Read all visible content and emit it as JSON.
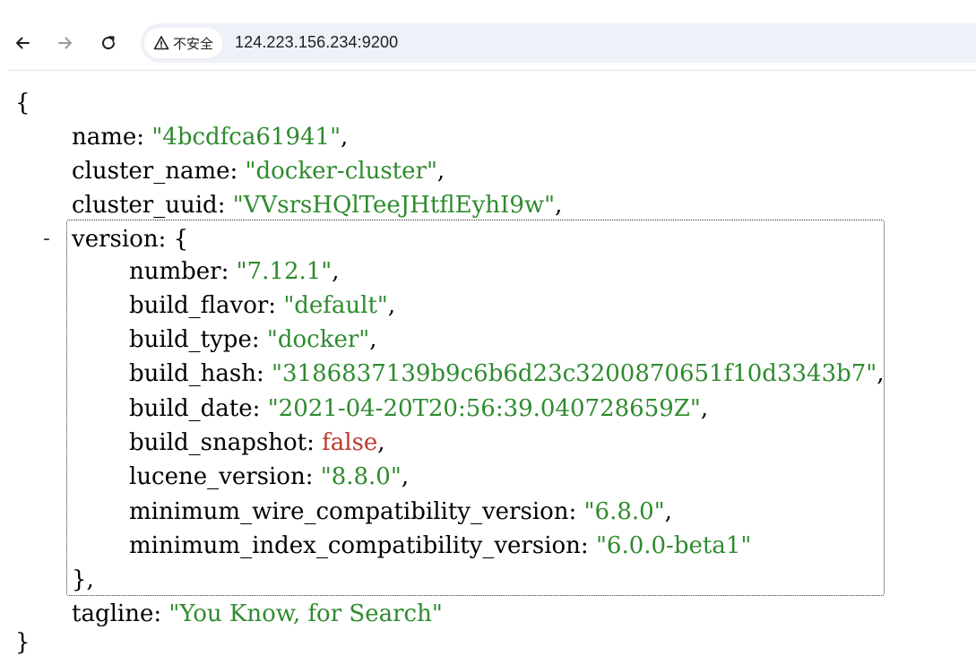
{
  "browser": {
    "security_label": "不安全",
    "url": "124.223.156.234:9200",
    "icons": {
      "back": "arrow-left-icon",
      "forward": "arrow-right-icon",
      "reload": "reload-icon",
      "warning": "warning-triangle-icon"
    }
  },
  "json": {
    "open_brace": "{",
    "close_brace": "}",
    "collapse_symbol": "-",
    "name": {
      "key": "name",
      "value": "\"4bcdfca61941\""
    },
    "cluster_name": {
      "key": "cluster_name",
      "value": "\"docker-cluster\""
    },
    "cluster_uuid": {
      "key": "cluster_uuid",
      "value": "\"VVsrsHQlTeeJHtflEyhI9w\""
    },
    "version": {
      "key": "version",
      "open": "{",
      "close": "},",
      "number": {
        "key": "number",
        "value": "\"7.12.1\""
      },
      "build_flavor": {
        "key": "build_flavor",
        "value": "\"default\""
      },
      "build_type": {
        "key": "build_type",
        "value": "\"docker\""
      },
      "build_hash": {
        "key": "build_hash",
        "value": "\"3186837139b9c6b6d23c3200870651f10d3343b7\""
      },
      "build_date": {
        "key": "build_date",
        "value": "\"2021-04-20T20:56:39.040728659Z\""
      },
      "build_snapshot": {
        "key": "build_snapshot",
        "value": "false"
      },
      "lucene_version": {
        "key": "lucene_version",
        "value": "\"8.8.0\""
      },
      "minimum_wire_compatibility_version": {
        "key": "minimum_wire_compatibility_version",
        "value": "\"6.8.0\""
      },
      "minimum_index_compatibility_version": {
        "key": "minimum_index_compatibility_version",
        "value": "\"6.0.0-beta1\""
      }
    },
    "tagline": {
      "key": "tagline",
      "value": "\"You Know, for Search\""
    }
  },
  "colors": {
    "string": "#2e8b2e",
    "boolean": "#c0392b",
    "omnibox": "#eef1f8"
  }
}
